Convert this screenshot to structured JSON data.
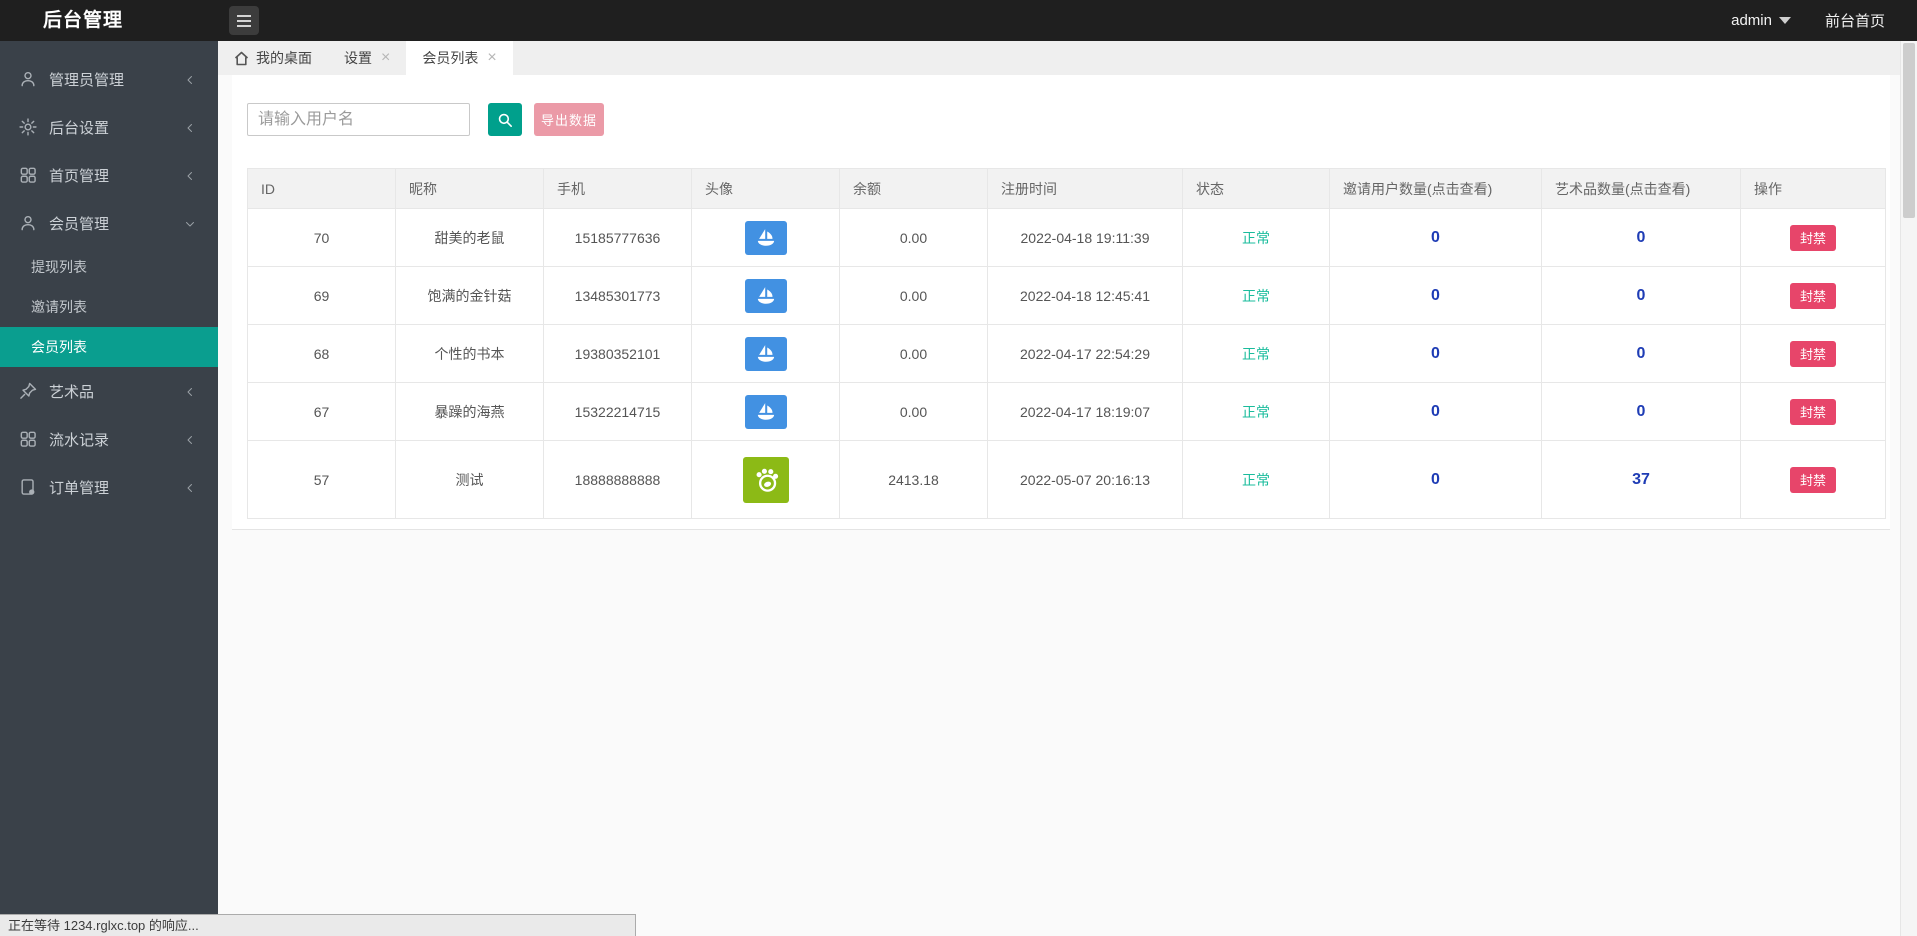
{
  "header": {
    "title": "后台管理",
    "user": "admin",
    "frontend_link": "前台首页"
  },
  "sidebar": {
    "items": [
      {
        "label": "管理员管理",
        "icon": "user-icon"
      },
      {
        "label": "后台设置",
        "icon": "gear-icon"
      },
      {
        "label": "首页管理",
        "icon": "grid-icon"
      },
      {
        "label": "会员管理",
        "icon": "user-icon",
        "expanded": true,
        "children": [
          {
            "label": "提现列表"
          },
          {
            "label": "邀请列表"
          },
          {
            "label": "会员列表",
            "active": true
          }
        ]
      },
      {
        "label": "艺术品",
        "icon": "pin-icon"
      },
      {
        "label": "流水记录",
        "icon": "grid-icon"
      },
      {
        "label": "订单管理",
        "icon": "file-icon"
      }
    ]
  },
  "tabs": [
    {
      "label": "我的桌面",
      "icon": "home-icon",
      "closable": false
    },
    {
      "label": "设置",
      "closable": true
    },
    {
      "label": "会员列表",
      "closable": true,
      "active": true
    }
  ],
  "toolbar": {
    "search_placeholder": "请输入用户名",
    "export_label": "导出数据"
  },
  "table": {
    "columns": [
      "ID",
      "昵称",
      "手机",
      "头像",
      "余额",
      "注册时间",
      "状态",
      "邀请用户数量(点击查看)",
      "艺术品数量(点击查看)",
      "操作"
    ],
    "rows": [
      {
        "id": "70",
        "nickname": "甜美的老鼠",
        "phone": "15185777636",
        "avatar": "boat-blue",
        "balance": "0.00",
        "reg_time": "2022-04-18 19:11:39",
        "status": "正常",
        "invite_count": "0",
        "art_count": "0",
        "action": "封禁"
      },
      {
        "id": "69",
        "nickname": "饱满的金针菇",
        "phone": "13485301773",
        "avatar": "boat-blue",
        "balance": "0.00",
        "reg_time": "2022-04-18 12:45:41",
        "status": "正常",
        "invite_count": "0",
        "art_count": "0",
        "action": "封禁"
      },
      {
        "id": "68",
        "nickname": "个性的书本",
        "phone": "19380352101",
        "avatar": "boat-blue",
        "balance": "0.00",
        "reg_time": "2022-04-17 22:54:29",
        "status": "正常",
        "invite_count": "0",
        "art_count": "0",
        "action": "封禁"
      },
      {
        "id": "67",
        "nickname": "暴躁的海燕",
        "phone": "15322214715",
        "avatar": "boat-blue",
        "balance": "0.00",
        "reg_time": "2022-04-17 18:19:07",
        "status": "正常",
        "invite_count": "0",
        "art_count": "0",
        "action": "封禁"
      },
      {
        "id": "57",
        "nickname": "测试",
        "phone": "18888888888",
        "avatar": "paw-green",
        "balance": "2413.18",
        "reg_time": "2022-05-07 20:16:13",
        "status": "正常",
        "invite_count": "0",
        "art_count": "37",
        "action": "封禁"
      }
    ]
  },
  "statusbar": {
    "text": "正在等待 1234.rglxc.top 的响应..."
  },
  "colors": {
    "topbar": "#1f1f1f",
    "sidebar": "#3a4149",
    "menu-active": "#0a9e8f",
    "btn-search": "#00a08c",
    "btn-export": "#eb9aa7",
    "btn-ban": "#e7456a",
    "status-ok": "#1abc9c",
    "link-blue": "#1e3cb5",
    "avatar-blue": "#4291e2",
    "avatar-green": "#8cba16"
  }
}
